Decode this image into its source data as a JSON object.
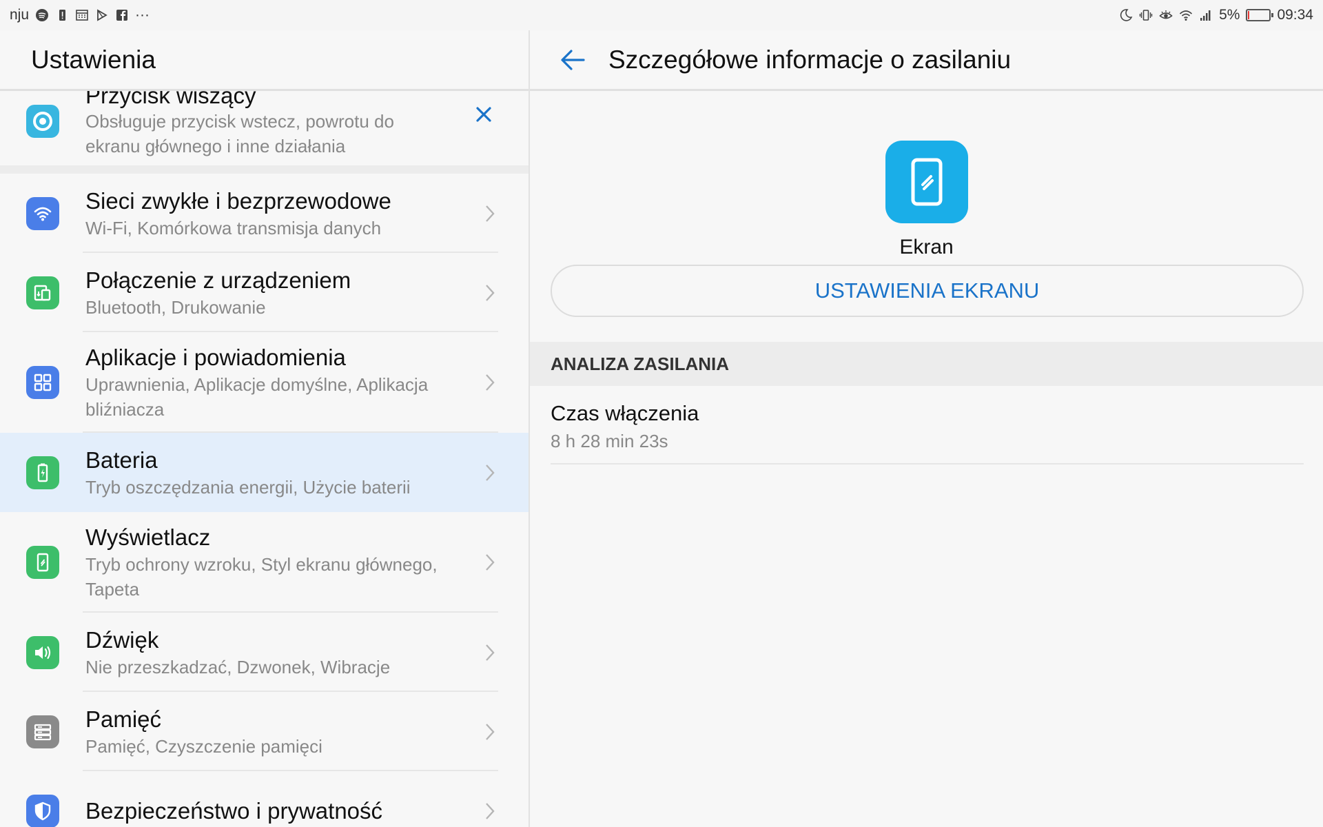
{
  "status_bar": {
    "carrier": "nju",
    "battery_percent": "5%",
    "battery_level": 0.05,
    "time": "09:34",
    "more_indicator": "···",
    "left_icons": [
      "spotify-icon",
      "battery-alert-icon",
      "calendar-icon",
      "play-store-icon",
      "facebook-icon"
    ],
    "right_icons": [
      "moon-icon",
      "vibrate-icon",
      "eye-comfort-icon",
      "wifi-icon",
      "signal-icon"
    ]
  },
  "left_panel": {
    "title": "Ustawienia",
    "dock_card": {
      "title": "Przycisk wiszący",
      "description": "Obsługuje przycisk wstecz, powrotu do ekranu głównego i inne działania",
      "icon": "navigation-dock-icon",
      "icon_color": "#38b6e0"
    },
    "items": [
      {
        "title": "Sieci zwykłe i bezprzewodowe",
        "subtitle": "Wi-Fi, Komórkowa transmisja danych",
        "icon": "wifi-icon",
        "color": "#4a7ee8"
      },
      {
        "title": "Połączenie z urządzeniem",
        "subtitle": "Bluetooth, Drukowanie",
        "icon": "device-connection-icon",
        "color": "#3dbe6a"
      },
      {
        "title": "Aplikacje i powiadomienia",
        "subtitle": "Uprawnienia, Aplikacje domyślne, Aplikacja bliźniacza",
        "icon": "apps-grid-icon",
        "color": "#4a7ee8"
      },
      {
        "title": "Bateria",
        "subtitle": "Tryb oszczędzania energii, Użycie baterii",
        "icon": "battery-icon",
        "color": "#3dbe6a",
        "selected": true
      },
      {
        "title": "Wyświetlacz",
        "subtitle": "Tryb ochrony wzroku, Styl ekranu głównego, Tapeta",
        "icon": "display-icon",
        "color": "#3dbe6a"
      },
      {
        "title": "Dźwięk",
        "subtitle": "Nie przeszkadzać, Dzwonek, Wibracje",
        "icon": "speaker-icon",
        "color": "#3dbe6a"
      },
      {
        "title": "Pamięć",
        "subtitle": "Pamięć, Czyszczenie pamięci",
        "icon": "storage-icon",
        "color": "#8a8a8a"
      },
      {
        "title": "Bezpieczeństwo i prywatność",
        "subtitle": "",
        "icon": "shield-icon",
        "color": "#4a7ee8"
      }
    ]
  },
  "right_panel": {
    "title": "Szczegółowe informacje o zasilaniu",
    "app": {
      "name": "Ekran",
      "icon": "screen-icon",
      "color": "#1aaee8"
    },
    "settings_button": "USTAWIENIA EKRANU",
    "section_title": "ANALIZA ZASILANIA",
    "stat": {
      "label": "Czas włączenia",
      "value": "8 h 28 min 23s"
    }
  },
  "colors": {
    "accent": "#1a73c9",
    "selected_bg": "#e3eefb"
  }
}
